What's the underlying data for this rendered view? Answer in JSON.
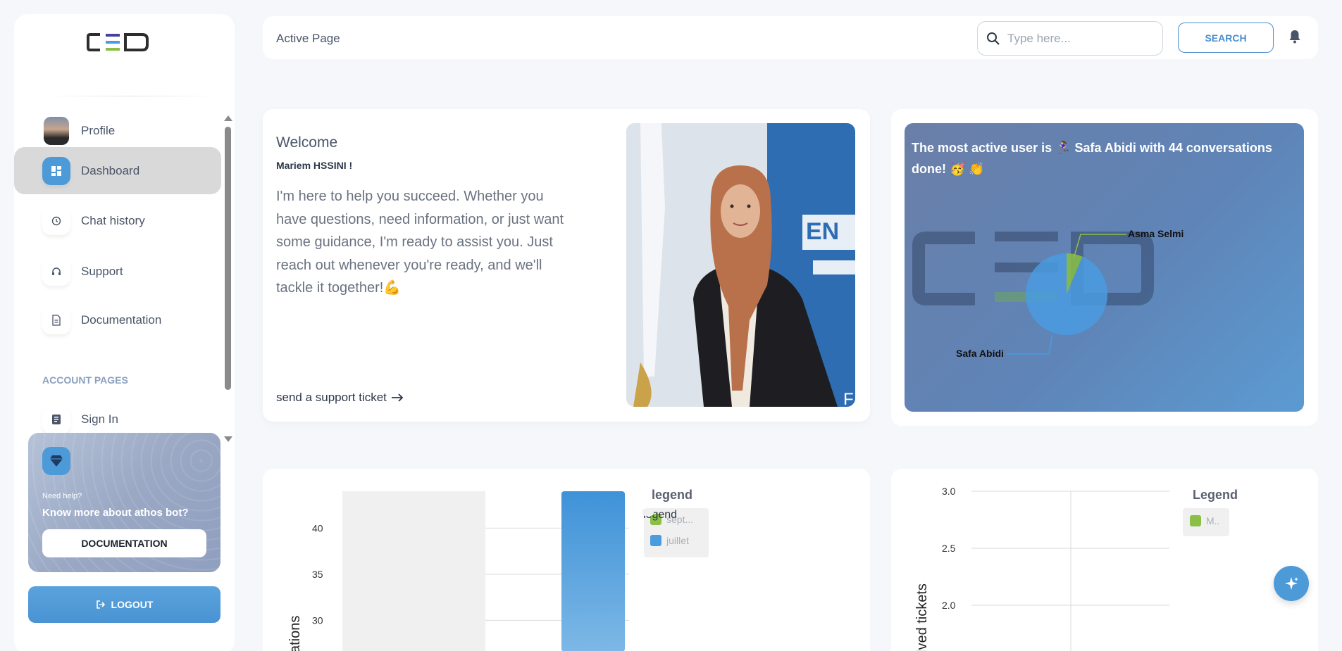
{
  "sidebar": {
    "items": [
      {
        "label": "Profile",
        "icon": "avatar"
      },
      {
        "label": "Dashboard",
        "icon": "dashboard-icon"
      },
      {
        "label": "Chat history",
        "icon": "history-icon"
      },
      {
        "label": "Support",
        "icon": "headset-icon"
      },
      {
        "label": "Documentation",
        "icon": "document-icon"
      }
    ],
    "account_section": "ACCOUNT PAGES",
    "account_items": [
      {
        "label": "Sign In",
        "icon": "sign-in-icon"
      }
    ],
    "help": {
      "small": "Need help?",
      "big": "Know more about athos bot?",
      "button": "DOCUMENTATION"
    },
    "logout": "LOGOUT"
  },
  "navbar": {
    "breadcrumb": "Active Page",
    "search_placeholder": "Type here...",
    "search_button": "SEARCH"
  },
  "welcome": {
    "title": "Welcome",
    "name": "Mariem HSSINI !",
    "text": "I'm here to help you succeed. Whether you have questions, need information, or just want some guidance, I'm ready to assist you. Just reach out whenever you're ready, and we'll tackle it together!💪",
    "link": "send a support ticket"
  },
  "active_user": {
    "text": "The most active user is 🏃‍♀️ Safa Abidi with 44 conversations done! 🥳 👏",
    "chart_data": {
      "type": "pie",
      "slices": [
        {
          "label": "Safa Abidi",
          "value": 44,
          "color": "#4a9be0"
        },
        {
          "label": "Asma Selmi",
          "value": 3,
          "color": "#8bbf45"
        }
      ]
    }
  },
  "chart_data": [
    {
      "type": "bar",
      "categories": [
        "sept...",
        "juillet"
      ],
      "series": [
        {
          "name": "sept...",
          "values": [
            null,
            null
          ],
          "color": "#8bbf45"
        },
        {
          "name": "juillet",
          "values": [
            null,
            44
          ],
          "color": "#4a9be0"
        }
      ],
      "ylabel": "ations",
      "yticks": [
        30,
        35,
        40
      ],
      "legend_title": "legend"
    },
    {
      "type": "line",
      "ylabel": "lved tickets",
      "yticks": [
        "3.0",
        "2.5",
        "2.0"
      ],
      "legend_title": "Legend",
      "series": [
        {
          "name": "M..",
          "color": "#8bbf45"
        }
      ]
    }
  ],
  "colors": {
    "accent": "#4d9ad9",
    "active_nav": "#d9d9d9"
  }
}
